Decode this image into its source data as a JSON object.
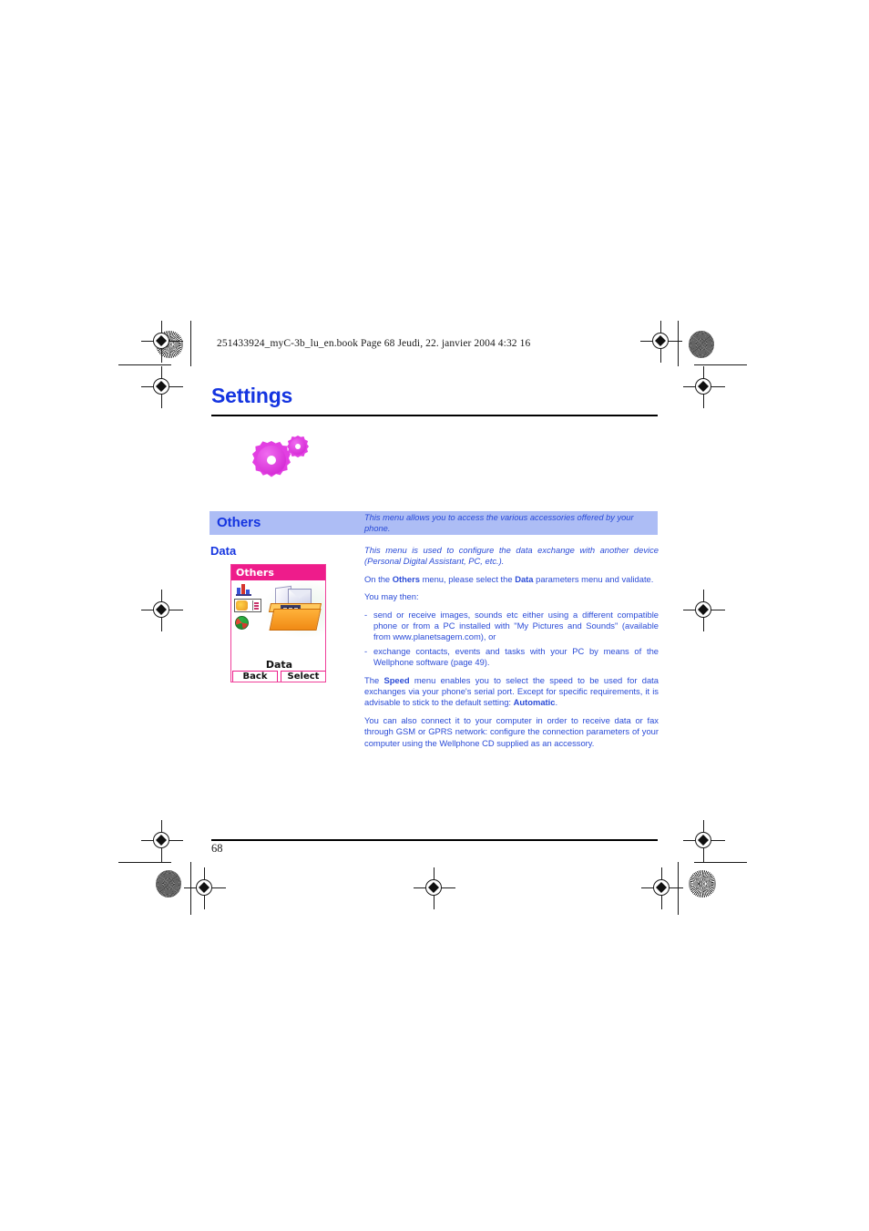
{
  "page": {
    "header_code": "251433924_myC-3b_lu_en.book  Page 68  Jeudi, 22. janvier 2004  4:32 16",
    "title": "Settings",
    "page_number": "68",
    "title_color": "#1434e0",
    "band_color": "#adbdf5",
    "body_color": "#2a4bd7"
  },
  "section": {
    "heading": "Others",
    "heading_description": "This menu allows you to access the various accessories offered by your phone.",
    "subheading": "Data",
    "intro_italic": "This menu is used to configure the data exchange with another device (Personal Digital Assistant, PC, etc.).",
    "para_select_1": "On the ",
    "para_select_b1": "Others",
    "para_select_2": " menu, please select the ",
    "para_select_b2": "Data",
    "para_select_3": " parameters menu and validate.",
    "you_may_then": "You may then:",
    "bullets": [
      {
        "dash": "-",
        "text": "send or receive images, sounds etc either using a different compatible phone or from a PC installed with \"My Pictures and Sounds\" (available from www.planetsagem.com), or"
      },
      {
        "dash": "-",
        "text": "exchange contacts, events and tasks with your PC by means of the Wellphone software (page 49)."
      }
    ],
    "para_speed_1": "The ",
    "para_speed_b1": "Speed",
    "para_speed_2": " menu enables you to select the speed to be used for data exchanges via your phone's serial port. Except for specific requirements, it is advisable to stick to the default setting: ",
    "para_speed_b2": "Automatic",
    "para_speed_3": ".",
    "para_connect": "You can also connect it to your computer in order to receive data or fax through GSM or GPRS network: configure the connection parameters of your computer using the Wellphone CD supplied as an accessory."
  },
  "phone_screenshot": {
    "title": "Others",
    "caption": "Data",
    "softkey_left": "Back",
    "softkey_right": "Select",
    "title_bar_color": "#ee1c8b",
    "icons": [
      "bar-chart-icon",
      "converter-icon",
      "globe-icon",
      "data-tray-icon"
    ]
  },
  "icons": {
    "gears": "gears-icon",
    "gear_color": "#e23fe2"
  }
}
